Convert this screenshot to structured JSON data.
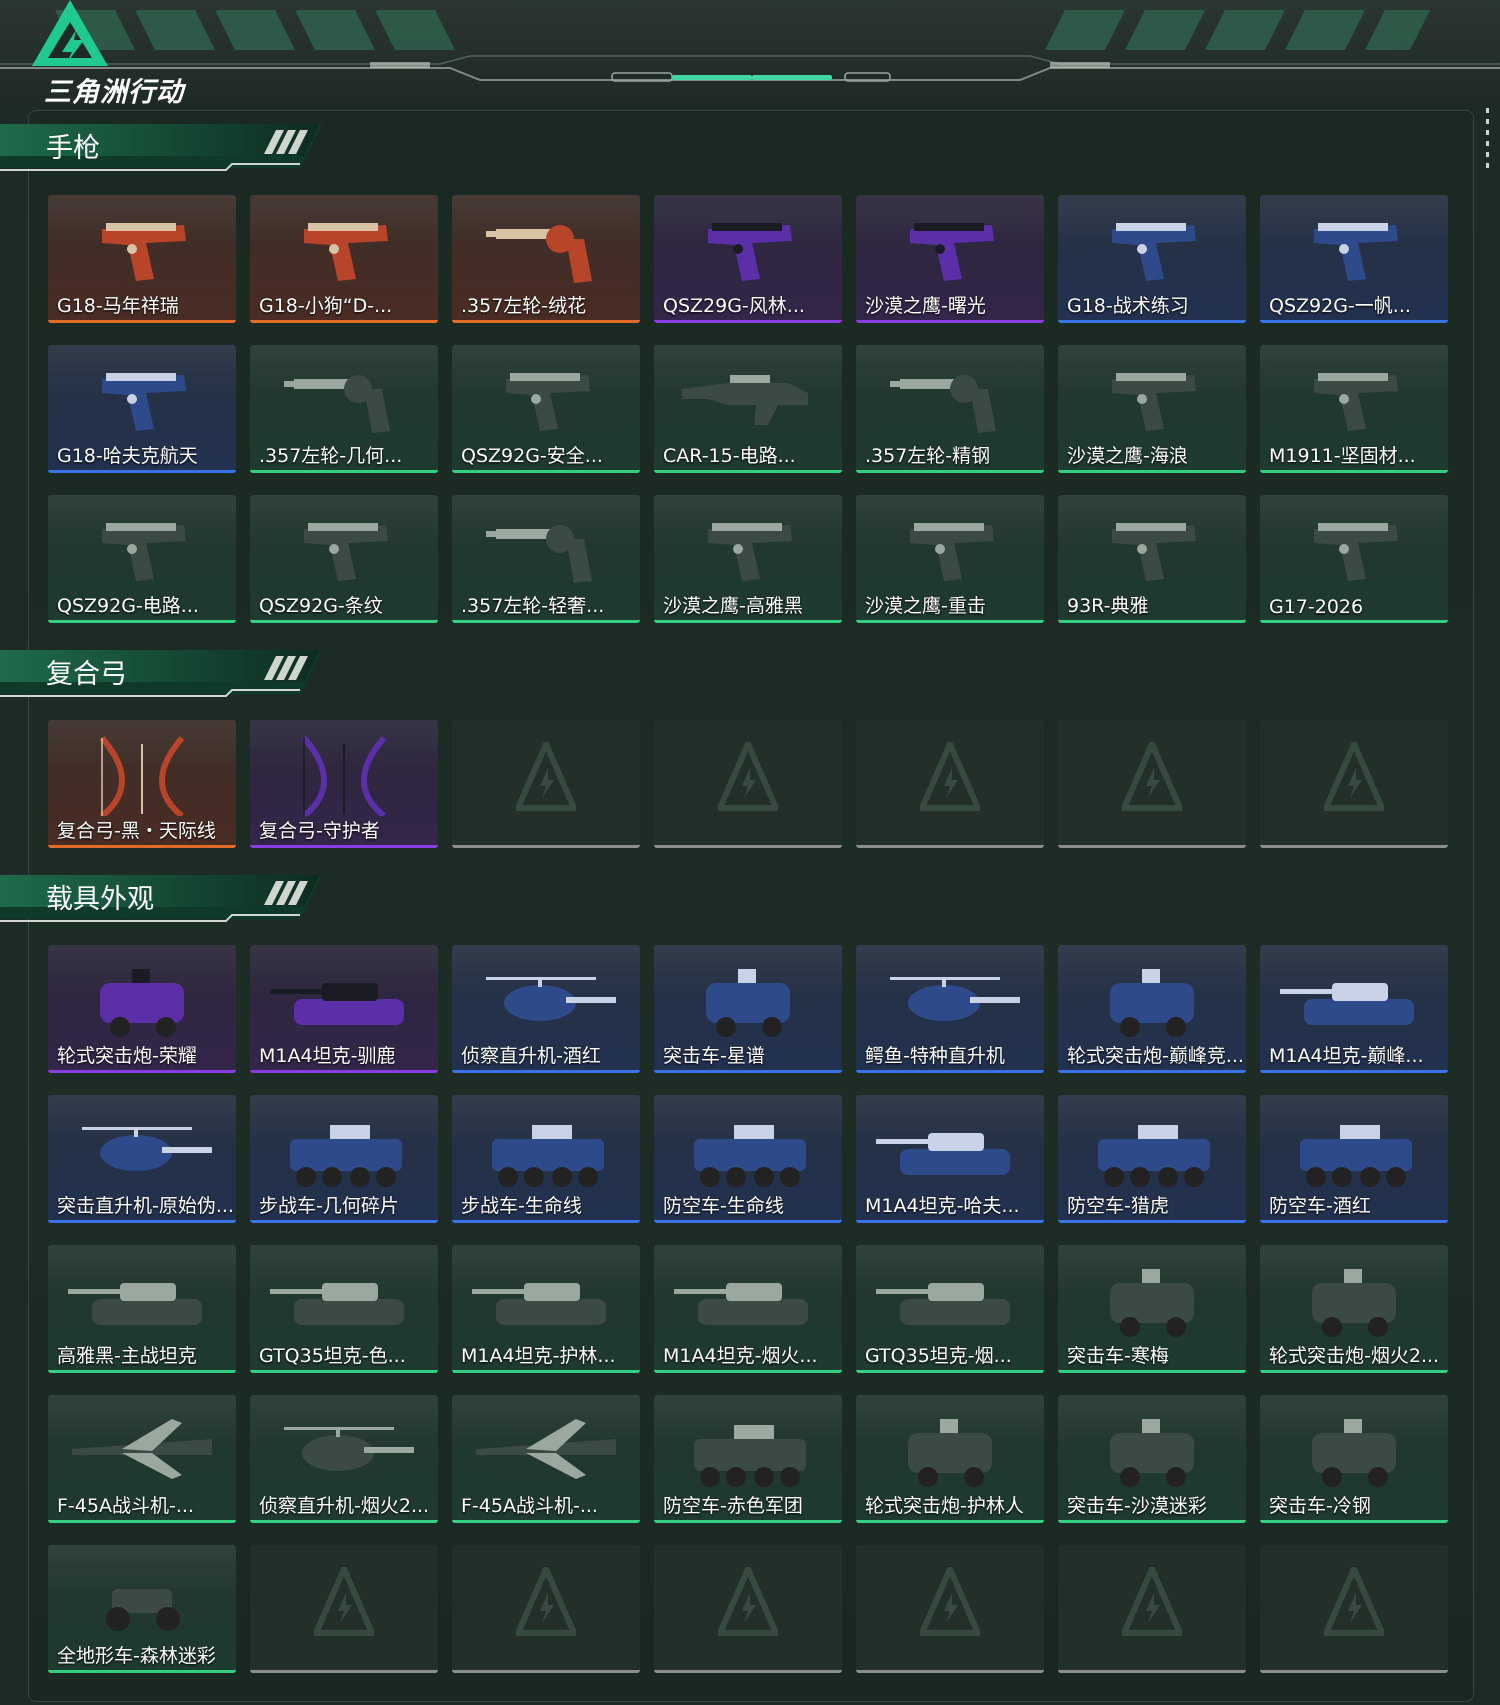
{
  "app": {
    "logo_text": "三角洲行动"
  },
  "colors": {
    "orange": "#e36b2a",
    "purple": "#8a3de0",
    "blue": "#3a73e6",
    "green": "#35cf84",
    "accent": "#2ee0a0"
  },
  "sections": [
    {
      "title": "手枪",
      "items": [
        {
          "label": "G18-马年祥瑞",
          "rarity": "orange",
          "icon": "pistol-icon"
        },
        {
          "label": "G18-小狗“D-...",
          "rarity": "orange",
          "icon": "pistol-icon"
        },
        {
          "label": ".357左轮-绒花",
          "rarity": "orange",
          "icon": "revolver-icon"
        },
        {
          "label": "QSZ29G-风林...",
          "rarity": "purple",
          "icon": "pistol-icon"
        },
        {
          "label": "沙漠之鹰-曙光",
          "rarity": "purple",
          "icon": "pistol-icon"
        },
        {
          "label": "G18-战术练习",
          "rarity": "blue",
          "icon": "pistol-icon"
        },
        {
          "label": "QSZ92G-一帆...",
          "rarity": "blue",
          "icon": "pistol-icon"
        },
        {
          "label": "G18-哈夫克航天",
          "rarity": "blue",
          "icon": "pistol-icon"
        },
        {
          "label": ".357左轮-几何...",
          "rarity": "green",
          "icon": "revolver-icon"
        },
        {
          "label": "QSZ92G-安全...",
          "rarity": "green",
          "icon": "pistol-icon"
        },
        {
          "label": "CAR-15-电路...",
          "rarity": "green",
          "icon": "rifle-icon"
        },
        {
          "label": ".357左轮-精钢",
          "rarity": "green",
          "icon": "revolver-icon"
        },
        {
          "label": "沙漠之鹰-海浪",
          "rarity": "green",
          "icon": "pistol-icon"
        },
        {
          "label": "M1911-坚固材...",
          "rarity": "green",
          "icon": "pistol-icon"
        },
        {
          "label": "QSZ92G-电路...",
          "rarity": "green",
          "icon": "pistol-icon"
        },
        {
          "label": "QSZ92G-条纹",
          "rarity": "green",
          "icon": "pistol-icon"
        },
        {
          "label": ".357左轮-轻奢...",
          "rarity": "green",
          "icon": "revolver-icon"
        },
        {
          "label": "沙漠之鹰-高雅黑",
          "rarity": "green",
          "icon": "pistol-icon"
        },
        {
          "label": "沙漠之鹰-重击",
          "rarity": "green",
          "icon": "pistol-icon"
        },
        {
          "label": "93R-典雅",
          "rarity": "green",
          "icon": "pistol-icon"
        },
        {
          "label": "G17-2026",
          "rarity": "green",
          "icon": "pistol-icon"
        }
      ]
    },
    {
      "title": "复合弓",
      "items": [
        {
          "label": "复合弓-黑・天际线",
          "rarity": "orange",
          "icon": "bow-icon"
        },
        {
          "label": "复合弓-守护者",
          "rarity": "purple",
          "icon": "bow-icon"
        },
        {
          "empty": true
        },
        {
          "empty": true
        },
        {
          "empty": true
        },
        {
          "empty": true
        },
        {
          "empty": true
        }
      ]
    },
    {
      "title": "载具外观",
      "items": [
        {
          "label": "轮式突击炮-荣耀",
          "rarity": "purple",
          "icon": "armored-car-icon"
        },
        {
          "label": "M1A4坦克-驯鹿",
          "rarity": "purple",
          "icon": "tank-icon"
        },
        {
          "label": "侦察直升机-酒红",
          "rarity": "blue",
          "icon": "helicopter-icon"
        },
        {
          "label": "突击车-星谱",
          "rarity": "blue",
          "icon": "armored-car-icon"
        },
        {
          "label": "鳄鱼-特种直升机",
          "rarity": "blue",
          "icon": "helicopter-icon"
        },
        {
          "label": "轮式突击炮-巅峰竞...",
          "rarity": "blue",
          "icon": "armored-car-icon"
        },
        {
          "label": "M1A4坦克-巅峰...",
          "rarity": "blue",
          "icon": "tank-icon"
        },
        {
          "label": "突击直升机-原始伪...",
          "rarity": "blue",
          "icon": "helicopter-icon"
        },
        {
          "label": "步战车-几何碎片",
          "rarity": "blue",
          "icon": "apc-icon"
        },
        {
          "label": "步战车-生命线",
          "rarity": "blue",
          "icon": "apc-icon"
        },
        {
          "label": "防空车-生命线",
          "rarity": "blue",
          "icon": "apc-icon"
        },
        {
          "label": "M1A4坦克-哈夫...",
          "rarity": "blue",
          "icon": "tank-icon"
        },
        {
          "label": "防空车-猎虎",
          "rarity": "blue",
          "icon": "apc-icon"
        },
        {
          "label": "防空车-酒红",
          "rarity": "blue",
          "icon": "apc-icon"
        },
        {
          "label": "高雅黑-主战坦克",
          "rarity": "green",
          "icon": "tank-icon"
        },
        {
          "label": "GTQ35坦克-色...",
          "rarity": "green",
          "icon": "tank-icon"
        },
        {
          "label": "M1A4坦克-护林...",
          "rarity": "green",
          "icon": "tank-icon"
        },
        {
          "label": "M1A4坦克-烟火...",
          "rarity": "green",
          "icon": "tank-icon"
        },
        {
          "label": "GTQ35坦克-烟...",
          "rarity": "green",
          "icon": "tank-icon"
        },
        {
          "label": "突击车-寒梅",
          "rarity": "green",
          "icon": "armored-car-icon"
        },
        {
          "label": "轮式突击炮-烟火2...",
          "rarity": "green",
          "icon": "armored-car-icon"
        },
        {
          "label": "F-45A战斗机-...",
          "rarity": "green",
          "icon": "jet-icon"
        },
        {
          "label": "侦察直升机-烟火2...",
          "rarity": "green",
          "icon": "helicopter-icon"
        },
        {
          "label": "F-45A战斗机-...",
          "rarity": "green",
          "icon": "jet-icon"
        },
        {
          "label": "防空车-赤色军团",
          "rarity": "green",
          "icon": "apc-icon"
        },
        {
          "label": "轮式突击炮-护林人",
          "rarity": "green",
          "icon": "armored-car-icon"
        },
        {
          "label": "突击车-沙漠迷彩",
          "rarity": "green",
          "icon": "armored-car-icon"
        },
        {
          "label": "突击车-冷钢",
          "rarity": "green",
          "icon": "armored-car-icon"
        },
        {
          "label": "全地形车-森林迷彩",
          "rarity": "green",
          "icon": "atv-icon"
        },
        {
          "empty": true
        },
        {
          "empty": true
        },
        {
          "empty": true
        },
        {
          "empty": true
        },
        {
          "empty": true
        },
        {
          "empty": true
        }
      ]
    }
  ]
}
